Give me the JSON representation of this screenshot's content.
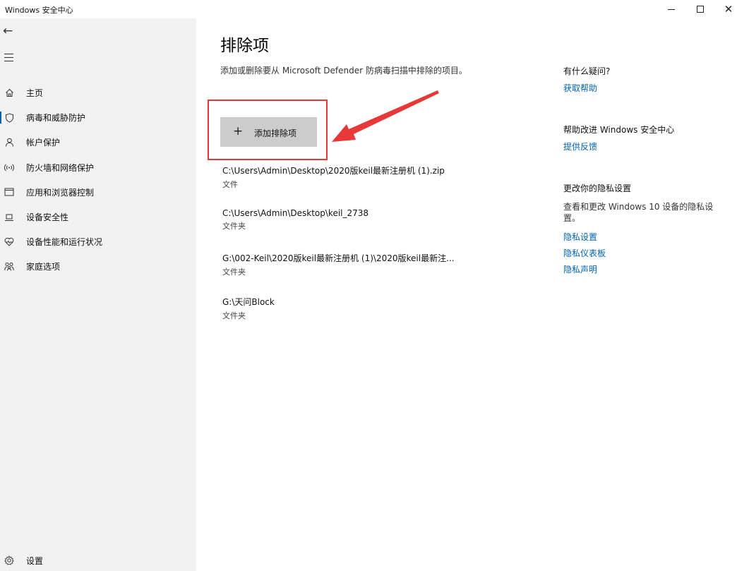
{
  "window": {
    "title": "Windows 安全中心",
    "controls": {
      "minimize": "–",
      "maximize": "□",
      "close": "✕"
    }
  },
  "sidebar": {
    "back_icon": "←",
    "items": [
      {
        "label": "主页",
        "icon": "home-icon",
        "active": false
      },
      {
        "label": "病毒和威胁防护",
        "icon": "shield-icon",
        "active": true
      },
      {
        "label": "帐户保护",
        "icon": "person-icon",
        "active": false
      },
      {
        "label": "防火墙和网络保护",
        "icon": "wireless-icon",
        "active": false
      },
      {
        "label": "应用和浏览器控制",
        "icon": "browser-window-icon",
        "active": false
      },
      {
        "label": "设备安全性",
        "icon": "laptop-icon",
        "active": false
      },
      {
        "label": "设备性能和运行状况",
        "icon": "heart-icon",
        "active": false
      },
      {
        "label": "家庭选项",
        "icon": "family-icon",
        "active": false
      }
    ],
    "settings_label": "设置"
  },
  "main": {
    "title": "排除项",
    "description": "添加或删除要从 Microsoft Defender 防病毒扫描中排除的项目。",
    "add_button_label": "添加排除项",
    "exclusions": [
      {
        "path": "C:\\Users\\Admin\\Desktop\\2020版keil最新注册机 (1).zip",
        "type": "文件"
      },
      {
        "path": "C:\\Users\\Admin\\Desktop\\keil_2738",
        "type": "文件夹"
      },
      {
        "path": "G:\\002-Keil\\2020版keil最新注册机 (1)\\2020版keil最新注...",
        "type": "文件夹"
      },
      {
        "path": "G:\\天问Block",
        "type": "文件夹"
      }
    ]
  },
  "side_panel": {
    "question_heading": "有什么疑问?",
    "get_help_link": "获取帮助",
    "improve_heading": "帮助改进 Windows 安全中心",
    "feedback_link": "提供反馈",
    "privacy_heading": "更改你的隐私设置",
    "privacy_text": "查看和更改 Windows 10 设备的隐私设置。",
    "privacy_links": [
      "隐私设置",
      "隐私仪表板",
      "隐私声明"
    ]
  },
  "colors": {
    "accent": "#0063b1",
    "annotation": "#e8393a",
    "sidebar_bg": "#f2f2f2",
    "button_bg": "#cccccc"
  }
}
